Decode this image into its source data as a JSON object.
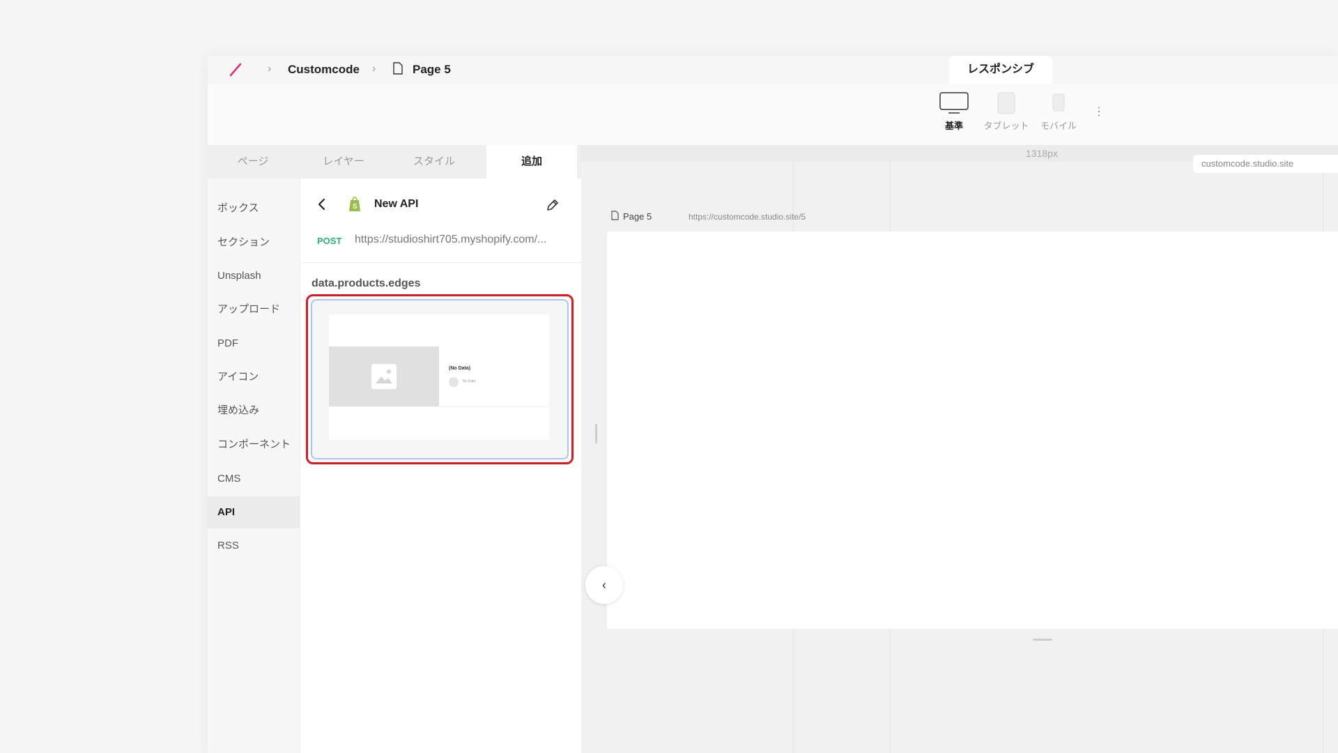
{
  "breadcrumb": {
    "project": "Customcode",
    "page": "Page 5"
  },
  "responsive_tab": "レスポンシブ",
  "devices": [
    {
      "label": "基準",
      "icon": "monitor-icon",
      "active": true
    },
    {
      "label": "タブレット",
      "icon": "tablet-icon",
      "active": false
    },
    {
      "label": "モバイル",
      "icon": "mobile-icon",
      "active": false
    }
  ],
  "tabs": [
    "ページ",
    "レイヤー",
    "スタイル",
    "追加"
  ],
  "active_tab": "追加",
  "categories": [
    "ボックス",
    "セクション",
    "Unsplash",
    "アップロード",
    "PDF",
    "アイコン",
    "埋め込み",
    "コンポーネント",
    "CMS",
    "API",
    "RSS"
  ],
  "active_category": "API",
  "api": {
    "name": "New API",
    "method": "POST",
    "endpoint": "https://studioshirt705.myshopify.com/...",
    "data_path": "data.products.edges",
    "preview_title": "(No Data)",
    "preview_sub": "No Data"
  },
  "canvas": {
    "width_label": "1318px",
    "domain": "customcode.studio.site",
    "page_label": "Page 5",
    "page_url": "https://customcode.studio.site/5"
  },
  "colors": {
    "accent_logo": "#e6287c",
    "method_green": "#2bb673",
    "highlight_red": "#e0181e",
    "selection_blue": "#a9c6ec",
    "shopify_green": "#95bf47"
  }
}
